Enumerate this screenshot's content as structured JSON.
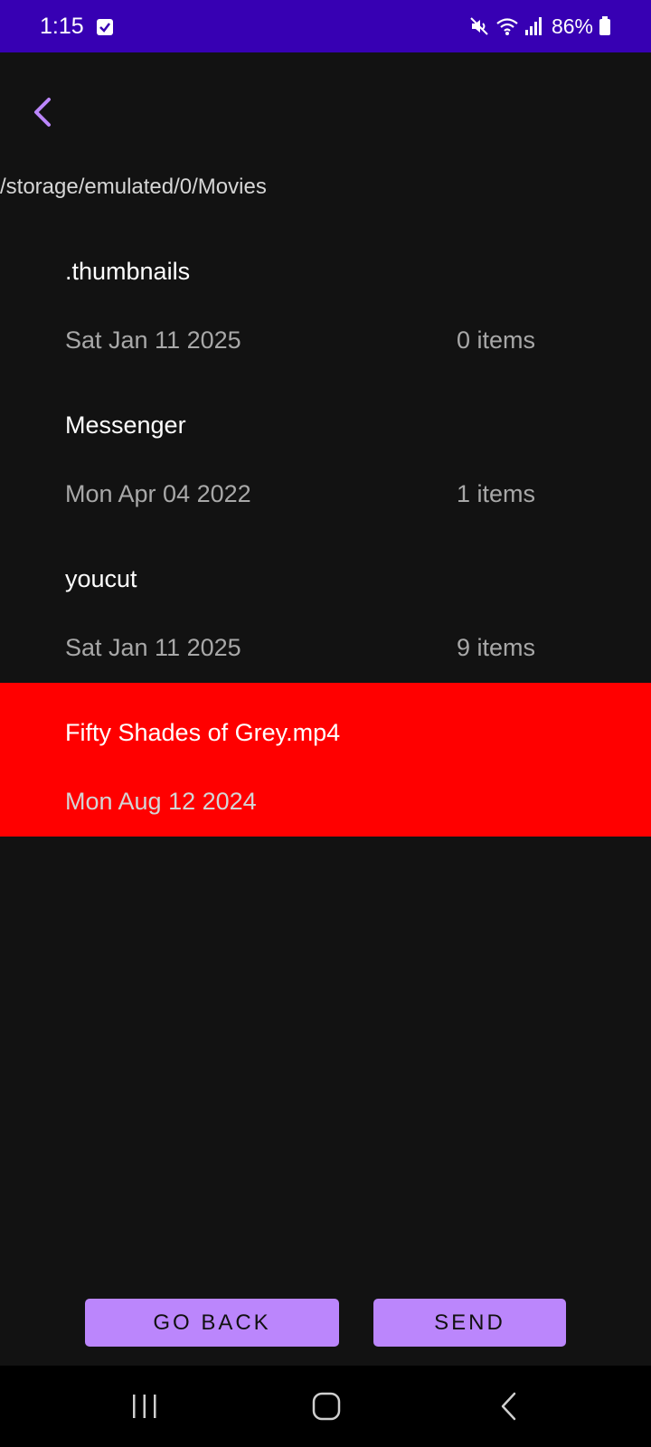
{
  "status_bar": {
    "time": "1:15",
    "battery": "86%",
    "icons": [
      "checkbox-notification-icon",
      "mute-icon",
      "wifi-icon",
      "signal-icon",
      "battery-icon"
    ]
  },
  "header": {
    "back_icon": "chevron-left-icon",
    "path": "/storage/emulated/0/Movies"
  },
  "files": [
    {
      "name": ".thumbnails",
      "date": "Sat Jan 11 2025",
      "count": "0 items",
      "selected": false
    },
    {
      "name": "Messenger",
      "date": "Mon Apr 04 2022",
      "count": "1 items",
      "selected": false
    },
    {
      "name": "youcut",
      "date": "Sat Jan 11 2025",
      "count": "9 items",
      "selected": false
    },
    {
      "name": "Fifty Shades of Grey.mp4",
      "date": "Mon Aug 12 2024",
      "count": "",
      "selected": true
    }
  ],
  "buttons": {
    "go_back": "GO BACK",
    "send": "SEND"
  },
  "nav_bar": {
    "icons": [
      "recents-icon",
      "home-icon",
      "back-icon"
    ]
  },
  "colors": {
    "status_bar": "#3700b3",
    "accent": "#bb86fc",
    "selected_row": "#ff0000",
    "background": "#121212"
  }
}
